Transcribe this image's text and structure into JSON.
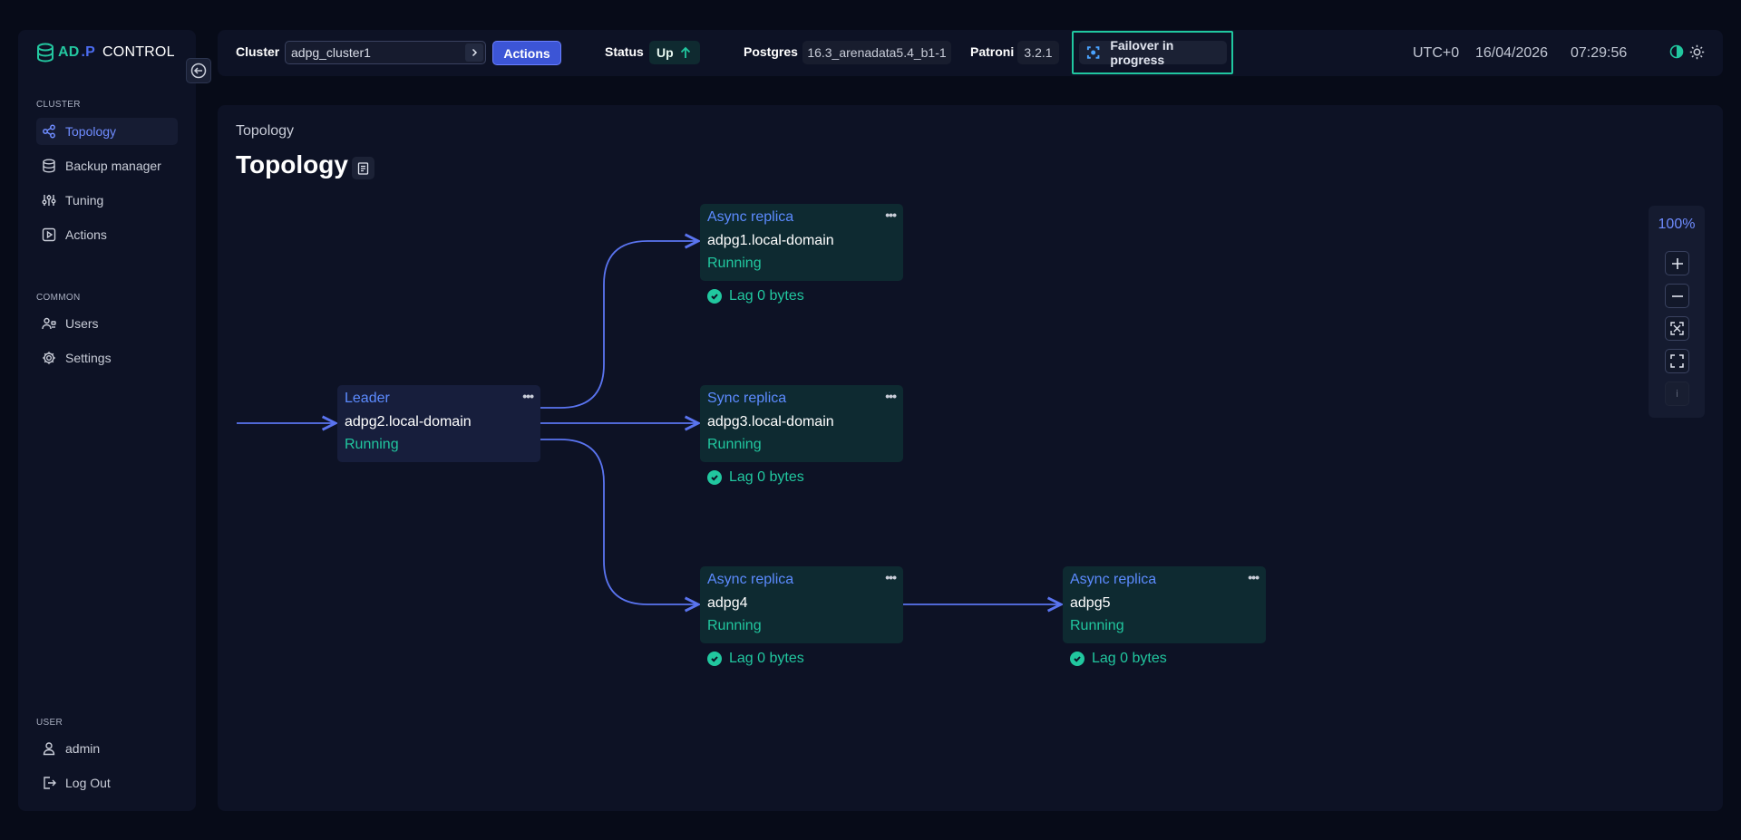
{
  "app": {
    "logo_part1": "AD",
    "logo_part2": ".P",
    "logo_part3": "CONTROL"
  },
  "sidebar": {
    "cluster_section": "CLUSTER",
    "cluster_items": [
      {
        "label": "Topology",
        "icon": "topology-icon",
        "active": true
      },
      {
        "label": "Backup manager",
        "icon": "database-icon"
      },
      {
        "label": "Tuning",
        "icon": "sliders-icon"
      },
      {
        "label": "Actions",
        "icon": "play-square-icon"
      }
    ],
    "common_section": "COMMON",
    "common_items": [
      {
        "label": "Users",
        "icon": "users-icon"
      },
      {
        "label": "Settings",
        "icon": "gear-icon"
      }
    ],
    "user_section": "USER",
    "user_items": [
      {
        "label": "admin",
        "icon": "user-icon"
      },
      {
        "label": "Log Out",
        "icon": "logout-icon"
      }
    ]
  },
  "header": {
    "cluster_label": "Cluster",
    "cluster_value": "adpg_cluster1",
    "actions_label": "Actions",
    "status_label": "Status",
    "status_value": "Up",
    "postgres_label": "Postgres",
    "postgres_value": "16.3_arenadata5.4_b1-1",
    "patroni_label": "Patroni",
    "patroni_value": "3.2.1",
    "failover_label": "Failover in progress",
    "timezone": "UTC+0",
    "date": "16/04/2026",
    "time": "07:29:56"
  },
  "main": {
    "breadcrumb": "Topology",
    "title": "Topology"
  },
  "topology": {
    "nodes": [
      {
        "id": "leader",
        "role": "Leader",
        "host": "adpg2.local-domain",
        "state": "Running"
      },
      {
        "id": "n1",
        "role": "Async replica",
        "host": "adpg1.local-domain",
        "state": "Running",
        "lag": "Lag 0 bytes"
      },
      {
        "id": "n3",
        "role": "Sync replica",
        "host": "adpg3.local-domain",
        "state": "Running",
        "lag": "Lag 0 bytes"
      },
      {
        "id": "n4",
        "role": "Async replica",
        "host": "adpg4",
        "state": "Running",
        "lag": "Lag 0 bytes"
      },
      {
        "id": "n5",
        "role": "Async replica",
        "host": "adpg5",
        "state": "Running",
        "lag": "Lag 0 bytes"
      }
    ]
  },
  "zoom": {
    "level": "100%",
    "info_label": "i"
  },
  "colors": {
    "accent": "#4b6cf0",
    "success": "#21c79f",
    "failover_border": "#20c7a0"
  }
}
